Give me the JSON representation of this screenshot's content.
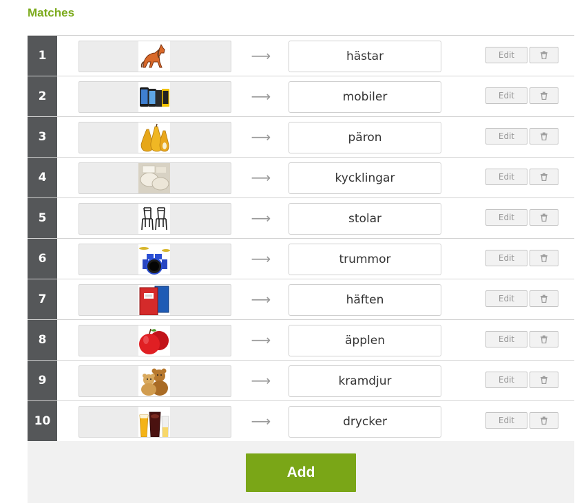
{
  "header": {
    "title": "Matches"
  },
  "matches": [
    {
      "number": "1",
      "word": "hästar",
      "image_icon": "horse-icon"
    },
    {
      "number": "2",
      "word": "mobiler",
      "image_icon": "phone-icon"
    },
    {
      "number": "3",
      "word": "päron",
      "image_icon": "pear-icon"
    },
    {
      "number": "4",
      "word": "kycklingar",
      "image_icon": "chicken-icon"
    },
    {
      "number": "5",
      "word": "stolar",
      "image_icon": "chair-icon"
    },
    {
      "number": "6",
      "word": "trummor",
      "image_icon": "drum-icon"
    },
    {
      "number": "7",
      "word": "häften",
      "image_icon": "notebook-icon"
    },
    {
      "number": "8",
      "word": "äpplen",
      "image_icon": "apple-icon"
    },
    {
      "number": "9",
      "word": "kramdjur",
      "image_icon": "teddy-bear-icon"
    },
    {
      "number": "10",
      "word": "drycker",
      "image_icon": "drink-icon"
    }
  ],
  "buttons": {
    "edit_label": "Edit",
    "add_label": "Add"
  },
  "colors": {
    "accent": "#7aa617",
    "number_column": "#555759"
  }
}
